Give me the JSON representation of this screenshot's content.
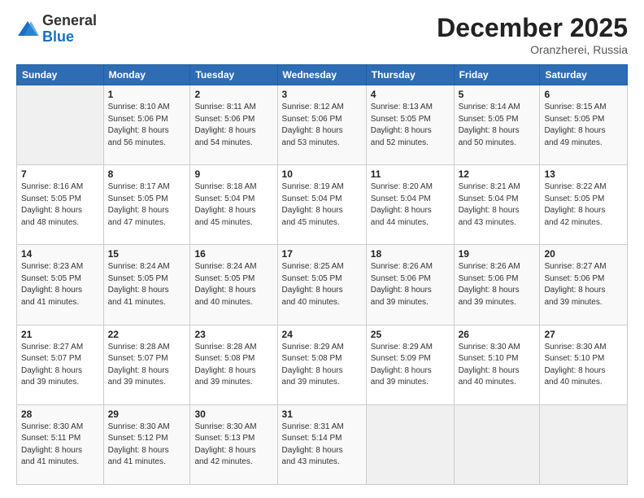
{
  "logo": {
    "general": "General",
    "blue": "Blue"
  },
  "header": {
    "month": "December 2025",
    "location": "Oranzherei, Russia"
  },
  "weekdays": [
    "Sunday",
    "Monday",
    "Tuesday",
    "Wednesday",
    "Thursday",
    "Friday",
    "Saturday"
  ],
  "weeks": [
    [
      {
        "num": "",
        "info": ""
      },
      {
        "num": "1",
        "info": "Sunrise: 8:10 AM\nSunset: 5:06 PM\nDaylight: 8 hours\nand 56 minutes."
      },
      {
        "num": "2",
        "info": "Sunrise: 8:11 AM\nSunset: 5:06 PM\nDaylight: 8 hours\nand 54 minutes."
      },
      {
        "num": "3",
        "info": "Sunrise: 8:12 AM\nSunset: 5:06 PM\nDaylight: 8 hours\nand 53 minutes."
      },
      {
        "num": "4",
        "info": "Sunrise: 8:13 AM\nSunset: 5:05 PM\nDaylight: 8 hours\nand 52 minutes."
      },
      {
        "num": "5",
        "info": "Sunrise: 8:14 AM\nSunset: 5:05 PM\nDaylight: 8 hours\nand 50 minutes."
      },
      {
        "num": "6",
        "info": "Sunrise: 8:15 AM\nSunset: 5:05 PM\nDaylight: 8 hours\nand 49 minutes."
      }
    ],
    [
      {
        "num": "7",
        "info": "Sunrise: 8:16 AM\nSunset: 5:05 PM\nDaylight: 8 hours\nand 48 minutes."
      },
      {
        "num": "8",
        "info": "Sunrise: 8:17 AM\nSunset: 5:05 PM\nDaylight: 8 hours\nand 47 minutes."
      },
      {
        "num": "9",
        "info": "Sunrise: 8:18 AM\nSunset: 5:04 PM\nDaylight: 8 hours\nand 45 minutes."
      },
      {
        "num": "10",
        "info": "Sunrise: 8:19 AM\nSunset: 5:04 PM\nDaylight: 8 hours\nand 45 minutes."
      },
      {
        "num": "11",
        "info": "Sunrise: 8:20 AM\nSunset: 5:04 PM\nDaylight: 8 hours\nand 44 minutes."
      },
      {
        "num": "12",
        "info": "Sunrise: 8:21 AM\nSunset: 5:04 PM\nDaylight: 8 hours\nand 43 minutes."
      },
      {
        "num": "13",
        "info": "Sunrise: 8:22 AM\nSunset: 5:05 PM\nDaylight: 8 hours\nand 42 minutes."
      }
    ],
    [
      {
        "num": "14",
        "info": "Sunrise: 8:23 AM\nSunset: 5:05 PM\nDaylight: 8 hours\nand 41 minutes."
      },
      {
        "num": "15",
        "info": "Sunrise: 8:24 AM\nSunset: 5:05 PM\nDaylight: 8 hours\nand 41 minutes."
      },
      {
        "num": "16",
        "info": "Sunrise: 8:24 AM\nSunset: 5:05 PM\nDaylight: 8 hours\nand 40 minutes."
      },
      {
        "num": "17",
        "info": "Sunrise: 8:25 AM\nSunset: 5:05 PM\nDaylight: 8 hours\nand 40 minutes."
      },
      {
        "num": "18",
        "info": "Sunrise: 8:26 AM\nSunset: 5:06 PM\nDaylight: 8 hours\nand 39 minutes."
      },
      {
        "num": "19",
        "info": "Sunrise: 8:26 AM\nSunset: 5:06 PM\nDaylight: 8 hours\nand 39 minutes."
      },
      {
        "num": "20",
        "info": "Sunrise: 8:27 AM\nSunset: 5:06 PM\nDaylight: 8 hours\nand 39 minutes."
      }
    ],
    [
      {
        "num": "21",
        "info": "Sunrise: 8:27 AM\nSunset: 5:07 PM\nDaylight: 8 hours\nand 39 minutes."
      },
      {
        "num": "22",
        "info": "Sunrise: 8:28 AM\nSunset: 5:07 PM\nDaylight: 8 hours\nand 39 minutes."
      },
      {
        "num": "23",
        "info": "Sunrise: 8:28 AM\nSunset: 5:08 PM\nDaylight: 8 hours\nand 39 minutes."
      },
      {
        "num": "24",
        "info": "Sunrise: 8:29 AM\nSunset: 5:08 PM\nDaylight: 8 hours\nand 39 minutes."
      },
      {
        "num": "25",
        "info": "Sunrise: 8:29 AM\nSunset: 5:09 PM\nDaylight: 8 hours\nand 39 minutes."
      },
      {
        "num": "26",
        "info": "Sunrise: 8:30 AM\nSunset: 5:10 PM\nDaylight: 8 hours\nand 40 minutes."
      },
      {
        "num": "27",
        "info": "Sunrise: 8:30 AM\nSunset: 5:10 PM\nDaylight: 8 hours\nand 40 minutes."
      }
    ],
    [
      {
        "num": "28",
        "info": "Sunrise: 8:30 AM\nSunset: 5:11 PM\nDaylight: 8 hours\nand 41 minutes."
      },
      {
        "num": "29",
        "info": "Sunrise: 8:30 AM\nSunset: 5:12 PM\nDaylight: 8 hours\nand 41 minutes."
      },
      {
        "num": "30",
        "info": "Sunrise: 8:30 AM\nSunset: 5:13 PM\nDaylight: 8 hours\nand 42 minutes."
      },
      {
        "num": "31",
        "info": "Sunrise: 8:31 AM\nSunset: 5:14 PM\nDaylight: 8 hours\nand 43 minutes."
      },
      {
        "num": "",
        "info": ""
      },
      {
        "num": "",
        "info": ""
      },
      {
        "num": "",
        "info": ""
      }
    ]
  ]
}
